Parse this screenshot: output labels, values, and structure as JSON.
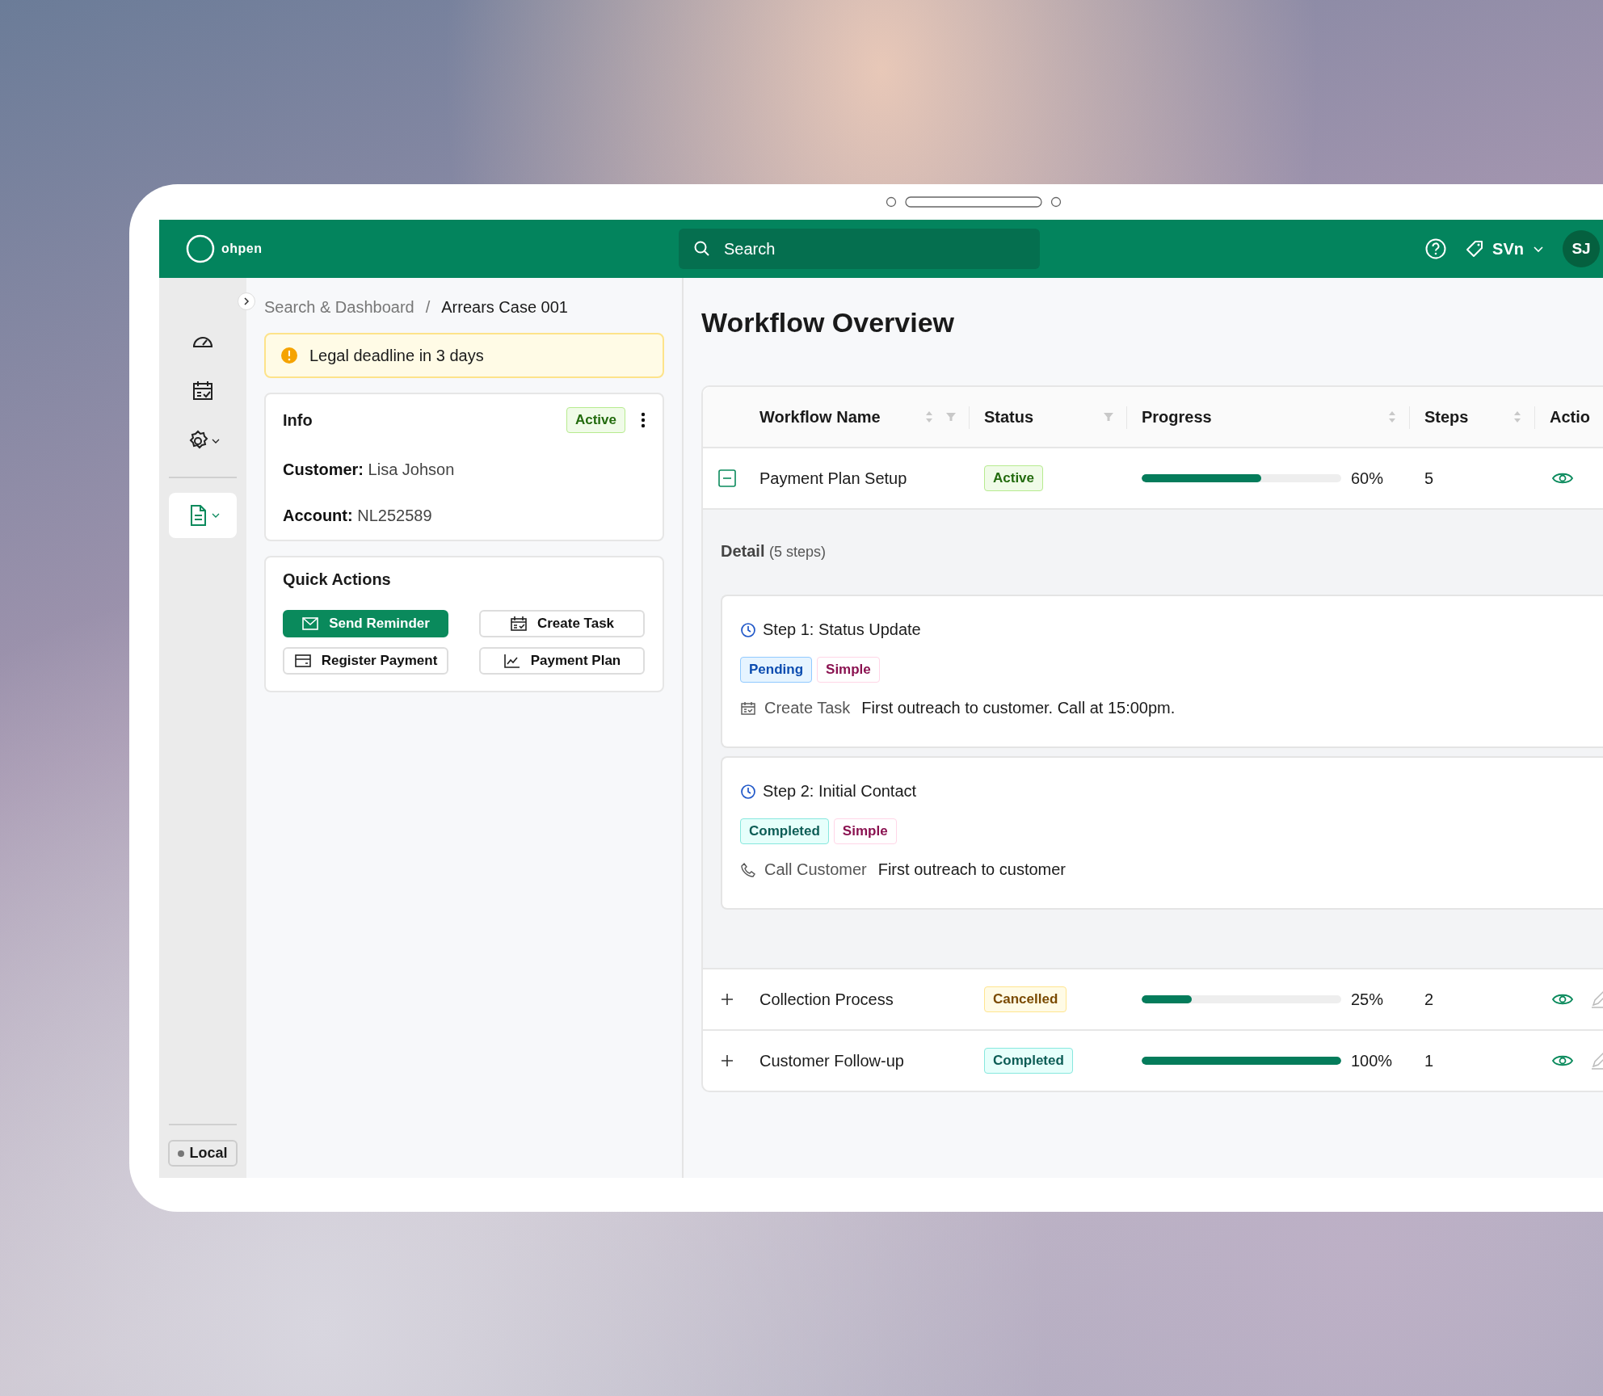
{
  "header": {
    "logo": "ohpen",
    "search": {
      "placeholder": "Search"
    },
    "workspace": "SVn",
    "avatar": "SJ"
  },
  "sidebar": {
    "items": [
      {
        "selected": false,
        "has_menu": false
      },
      {
        "selected": false,
        "has_menu": false
      },
      {
        "selected": false,
        "has_menu": true
      },
      {
        "selected": true,
        "has_menu": true
      }
    ],
    "environment": "Local"
  },
  "breadcrumb": {
    "items": [
      "Search & Dashboard",
      "Arrears Case 001"
    ],
    "separator": "/"
  },
  "alert": "Legal deadline in 3 days",
  "info": {
    "title": "Info",
    "status": {
      "label": "Active",
      "kind": "active"
    },
    "fields": [
      {
        "label": "Customer:",
        "value": "Lisa Johson"
      },
      {
        "label": "Account:",
        "value": "NL252589"
      }
    ]
  },
  "quick_actions": {
    "title": "Quick Actions",
    "buttons": [
      {
        "label": "Send Reminder",
        "primary": true
      },
      {
        "label": "Create Task",
        "primary": false
      },
      {
        "label": "Register Payment",
        "primary": false
      },
      {
        "label": "Payment Plan",
        "primary": false
      }
    ]
  },
  "main": {
    "title": "Workflow Overview",
    "table": {
      "columns": [
        {
          "label": "Workflow Name",
          "sortable": true,
          "filterable": true
        },
        {
          "label": "Status",
          "sortable": false,
          "filterable": true
        },
        {
          "label": "Progress",
          "sortable": true,
          "filterable": false
        },
        {
          "label": "Steps",
          "sortable": true,
          "filterable": false
        },
        {
          "label": "Actio"
        }
      ],
      "rows": [
        {
          "name": "Payment Plan Setup",
          "expanded": true,
          "status": {
            "label": "Active",
            "kind": "active"
          },
          "level": 0.6,
          "percent": "60%",
          "steps": "5",
          "detail": {
            "title": "Detail",
            "count": "(5 steps)",
            "steps": [
              {
                "title": "Step 1: Status Update",
                "tags": [
                  {
                    "label": "Pending",
                    "kind": "pending"
                  },
                  {
                    "label": "Simple",
                    "kind": "simple"
                  }
                ],
                "action": "Create Task",
                "description": "First outreach to customer. Call at 15:00pm."
              },
              {
                "title": "Step 2: Initial Contact",
                "tags": [
                  {
                    "label": "Completed",
                    "kind": "completed"
                  },
                  {
                    "label": "Simple",
                    "kind": "simple"
                  }
                ],
                "action": "Call Customer",
                "description": "First outreach to customer"
              }
            ]
          }
        },
        {
          "name": "Collection Process",
          "expanded": false,
          "status": {
            "label": "Cancelled",
            "kind": "cancelled"
          },
          "level": 0.25,
          "percent": "25%",
          "steps": "2"
        },
        {
          "name": "Customer Follow-up",
          "expanded": false,
          "status": {
            "label": "Completed",
            "kind": "completed"
          },
          "level": 1,
          "percent": "100%",
          "steps": "1"
        }
      ]
    }
  }
}
